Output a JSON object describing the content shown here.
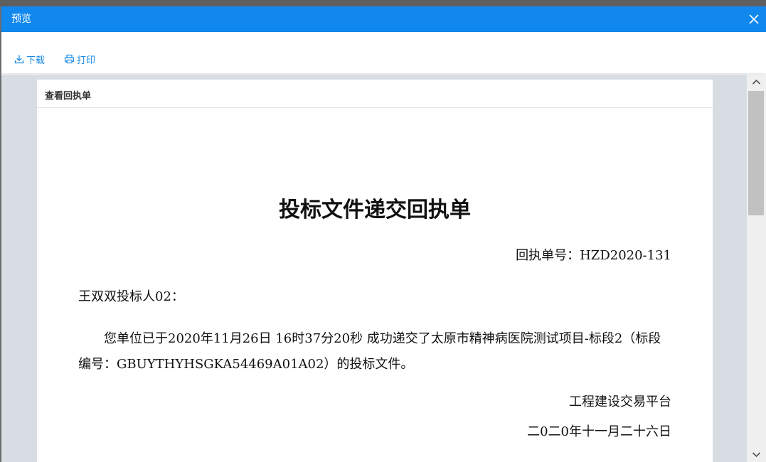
{
  "dialog": {
    "title": "预览",
    "accent_color": "#1088ee"
  },
  "toolbar": {
    "download_label": "下载",
    "print_label": "打印",
    "link_color": "#1a8be6"
  },
  "document": {
    "header_label": "查看回执单",
    "title": "投标文件递交回执单",
    "receipt_no": "回执单号：HZD2020-131",
    "recipient": "王双双投标人02：",
    "body": "您单位已于2020年11月26日 16时37分20秒 成功递交了太原市精神病医院测试项目-标段2（标段编号：GBUYTHYHSGKA54469A01A02）的投标文件。",
    "issuer": "工程建设交易平台",
    "date": "二0二0年十一月二十六日"
  },
  "icons": {
    "close": "close-icon",
    "download": "download-icon",
    "print": "printer-icon",
    "scroll_up": "chevron-up-icon",
    "scroll_down": "chevron-down-icon"
  }
}
